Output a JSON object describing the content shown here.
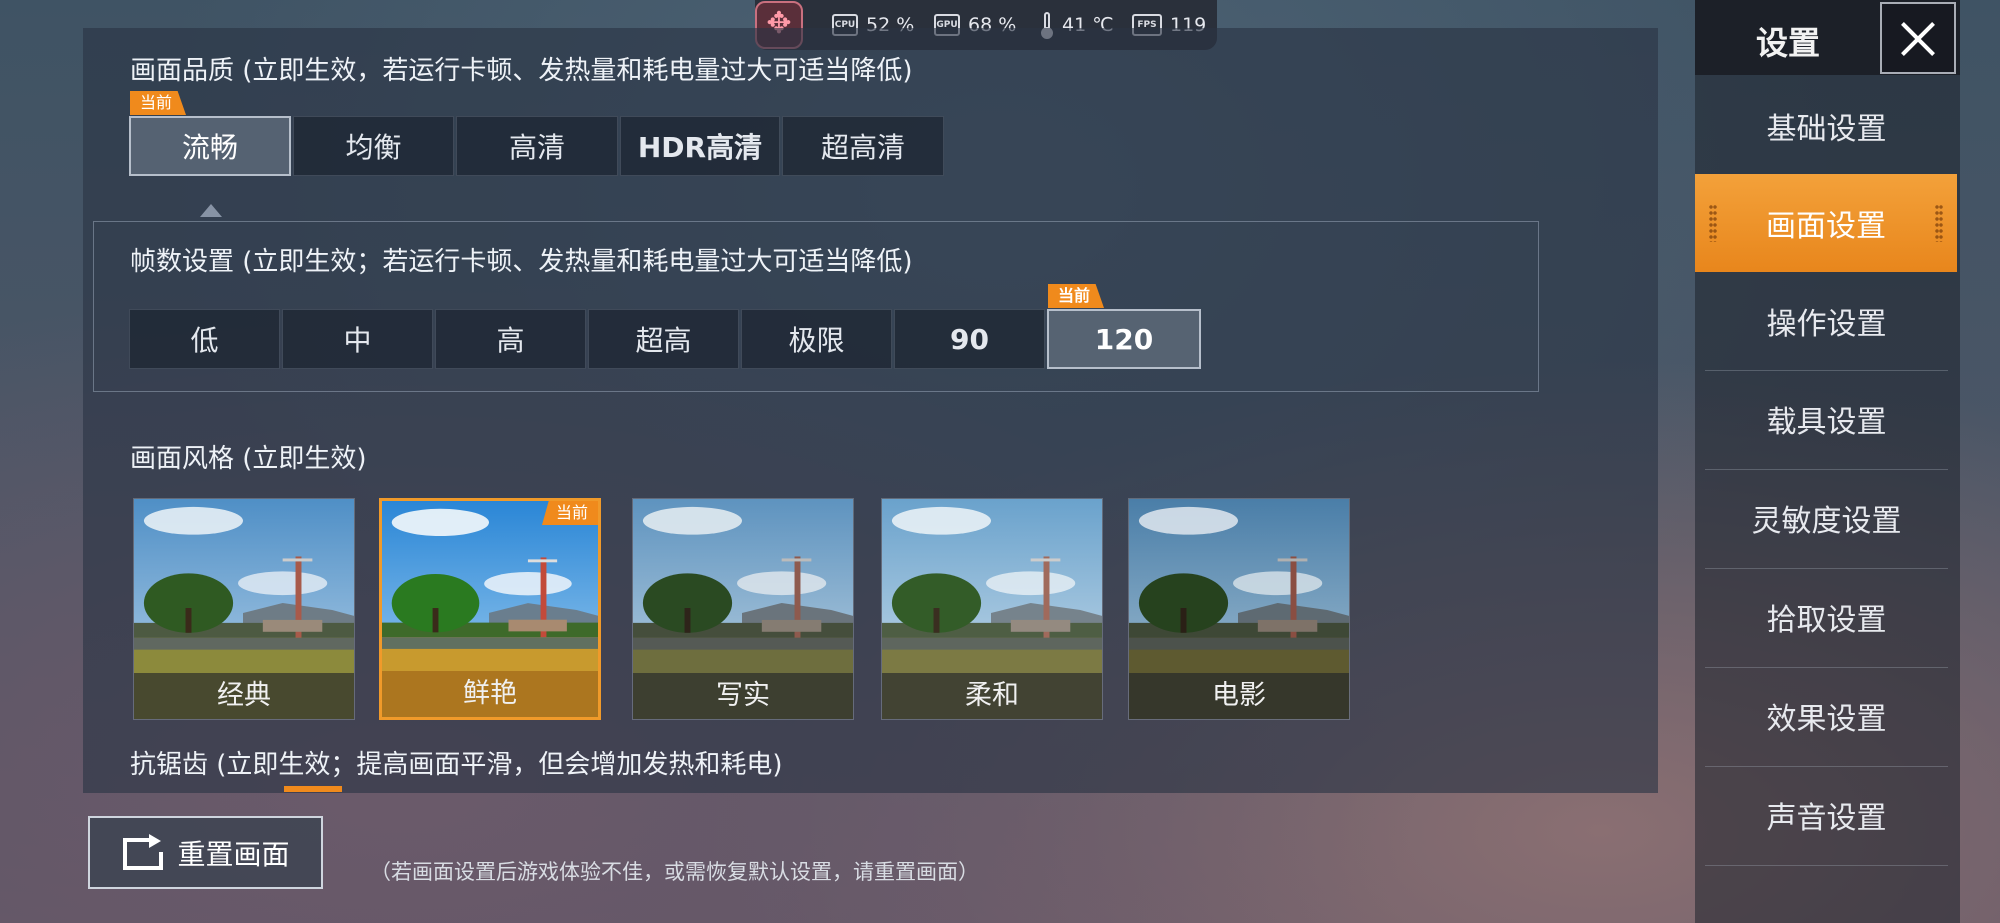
{
  "status": {
    "cpu": {
      "label": "CPU",
      "value": "52 %"
    },
    "gpu": {
      "label": "GPU",
      "value": "68 %"
    },
    "temp": {
      "value": "41 ℃"
    },
    "fps": {
      "label": "FPS",
      "value": "119"
    }
  },
  "quality": {
    "title": "画面品质 (立即生效，若运行卡顿、发热量和耗电量过大可适当降低)",
    "current_badge": "当前",
    "options": [
      "流畅",
      "均衡",
      "高清",
      "HDR高清",
      "超高清"
    ],
    "selected": "流畅"
  },
  "fps_settings": {
    "title": "帧数设置 (立即生效；若运行卡顿、发热量和耗电量过大可适当降低)",
    "current_badge": "当前",
    "options": [
      "低",
      "中",
      "高",
      "超高",
      "极限",
      "90",
      "120"
    ],
    "selected": "120"
  },
  "style": {
    "title": "画面风格 (立即生效)",
    "current_badge": "当前",
    "options": [
      "经典",
      "鲜艳",
      "写实",
      "柔和",
      "电影"
    ],
    "selected": "鲜艳"
  },
  "antialias": {
    "title": "抗锯齿 (立即生效；提高画面平滑，但会增加发热和耗电)"
  },
  "reset": {
    "label": "重置画面",
    "note": "（若画面设置后游戏体验不佳，或需恢复默认设置，请重置画面）"
  },
  "sidebar": {
    "title": "设置",
    "items": [
      "基础设置",
      "画面设置",
      "操作设置",
      "载具设置",
      "灵敏度设置",
      "拾取设置",
      "效果设置",
      "声音设置"
    ],
    "active": "画面设置"
  },
  "colors": {
    "accent": "#f08a1c",
    "panel": "#2a3444"
  },
  "icons": [
    "move-icon",
    "cpu-icon",
    "gpu-icon",
    "thermometer-icon",
    "fps-icon",
    "reset-icon",
    "close-icon"
  ]
}
